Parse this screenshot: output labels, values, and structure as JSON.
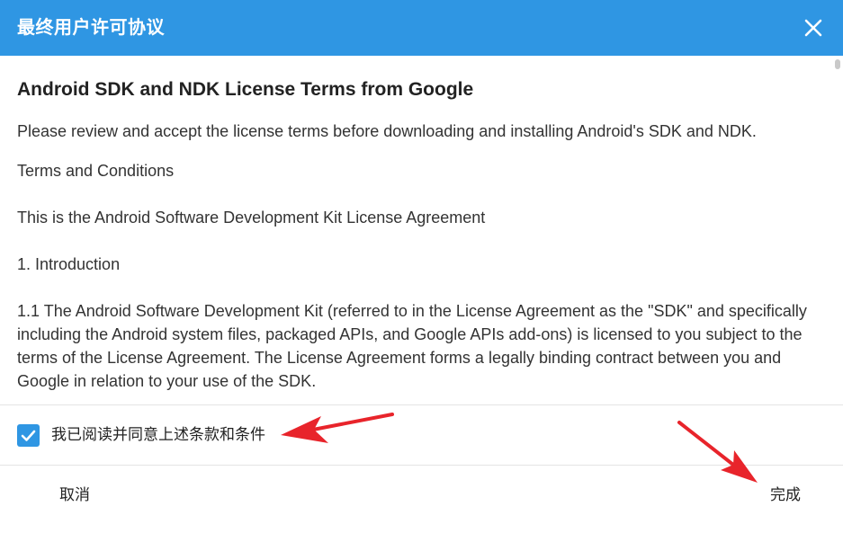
{
  "dialog": {
    "title": "最终用户许可协议",
    "close_icon": "close-icon",
    "accent_color": "#2f96e3"
  },
  "content": {
    "heading": "Android SDK and NDK License Terms from Google",
    "paragraphs": [
      "Please review and accept the license terms before downloading and installing Android's SDK and NDK.",
      "Terms and Conditions",
      "This is the Android Software Development Kit License Agreement",
      "1. Introduction",
      "1.1 The Android Software Development Kit (referred to in the License Agreement as the \"SDK\" and specifically including the Android system files, packaged APIs, and Google APIs add-ons) is licensed to you subject to the terms of the License Agreement. The License Agreement forms a legally binding contract between you and Google in relation to your use of the SDK."
    ]
  },
  "agreement": {
    "checked": true,
    "label": "我已阅读并同意上述条款和条件",
    "check_icon": "checkmark-icon"
  },
  "footer": {
    "cancel_label": "取消",
    "done_label": "完成"
  },
  "annotations": {
    "arrow_color": "#e8242b",
    "arrow_icon": "red-arrow"
  }
}
